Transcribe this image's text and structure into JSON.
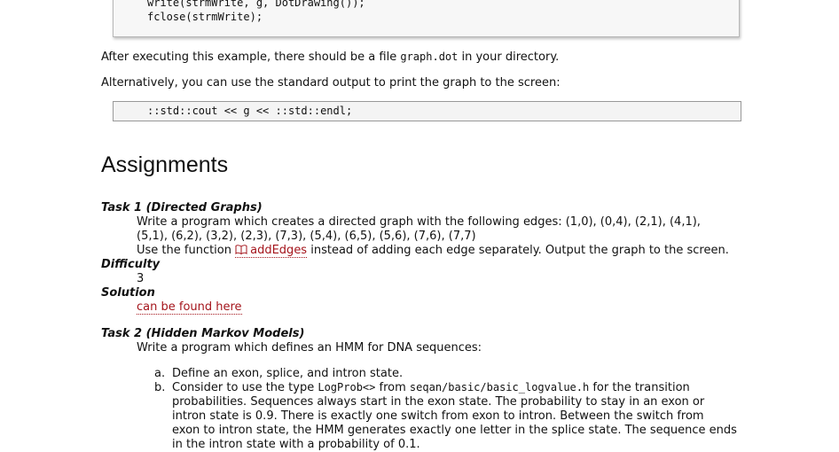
{
  "code_block_1": {
    "line1": "write(strmWrite, g, DotDrawing());",
    "line2": "fclose(strmWrite);"
  },
  "para_1": {
    "before": "After executing this example, there should be a file ",
    "code": "graph.dot",
    "after": " in your directory."
  },
  "para_2": "Alternatively, you can use the standard output to print the graph to the screen:",
  "code_block_2": "::std::cout << g << ::std::endl;",
  "heading": "Assignments",
  "task1": {
    "title": "Task 1 (Directed Graphs)",
    "line1": "Write a program which creates a directed graph with the following edges: (1,0), (0,4), (2,1), (4,1),",
    "line2": "(5,1), (6,2), (3,2), (2,3), (7,3), (5,4), (6,5), (5,6), (7,6), (7,7)",
    "line3_before": "Use the function ",
    "line3_link": "addEdges",
    "line3_after": " instead of adding each edge separately. Output the graph to the screen.",
    "link_icon": "book-icon"
  },
  "difficulty": {
    "label": "Difficulty",
    "value": "3"
  },
  "solution": {
    "label": "Solution",
    "link": "can be found here"
  },
  "task2": {
    "title": "Task 2 (Hidden Markov Models)",
    "intro": "Write a program which defines an HMM for DNA sequences:",
    "items": [
      {
        "marker": "a.",
        "lines": [
          "Define an exon, splice, and intron state."
        ]
      },
      {
        "marker": "b.",
        "line1_before": "Consider to use the type ",
        "line1_code1": "LogProb<>",
        "line1_mid": " from ",
        "line1_code2": "seqan/basic/basic_logvalue.h",
        "line1_after": " for the transition",
        "lines": [
          "probabilities. Sequences always start in the exon state. The probability to stay in an exon or",
          "intron state is 0.9. There is exactly one switch from exon to intron. Between the switch from",
          "exon to intron state, the HMM generates exactly one letter in the splice state. The sequence ends",
          "in the intron state with a probability of 0.1."
        ]
      }
    ]
  },
  "colors": {
    "link": "#a4151c",
    "code_bg": "#f7f7f7"
  }
}
